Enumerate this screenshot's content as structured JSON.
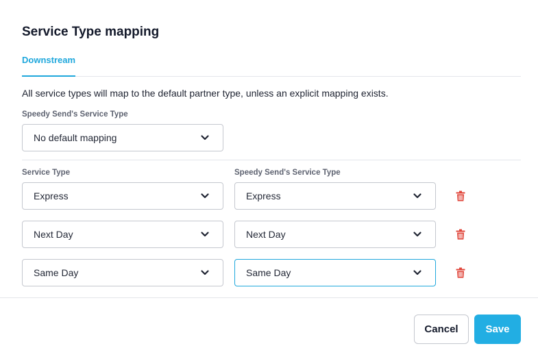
{
  "dialog": {
    "title": "Service Type mapping",
    "tabs": [
      {
        "label": "Downstream",
        "active": true
      }
    ],
    "description": "All service types will map to the default partner type, unless an explicit mapping exists.",
    "default_mapping": {
      "label": "Speedy Send's Service Type",
      "value": "No default mapping"
    },
    "mapping_table": {
      "columns": [
        "Service Type",
        "Speedy Send's Service Type"
      ],
      "rows": [
        {
          "service_type": "Express",
          "partner_type": "Express"
        },
        {
          "service_type": "Next Day",
          "partner_type": "Next Day"
        },
        {
          "service_type": "Same Day",
          "partner_type": "Same Day"
        }
      ]
    },
    "footer": {
      "cancel_label": "Cancel",
      "save_label": "Save"
    }
  },
  "icons": {
    "dropdown": "chevron-down-icon",
    "delete": "trash-icon"
  },
  "colors": {
    "accent": "#1ea7dc",
    "delete": "#e0453a",
    "primary_button": "#22aee3"
  }
}
